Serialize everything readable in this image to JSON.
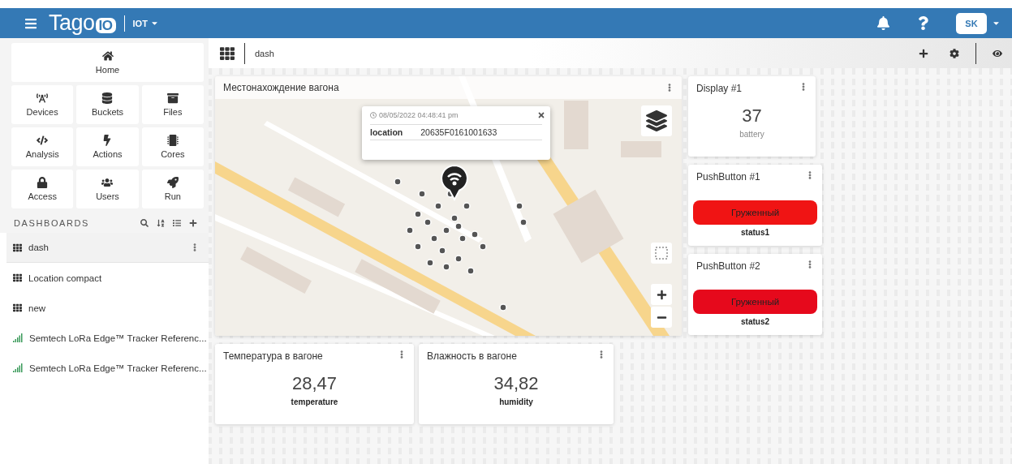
{
  "header": {
    "logo": "Tago",
    "logo_badge": "IO",
    "account": "IOT",
    "avatar": "SK"
  },
  "sidebar": {
    "nav": [
      {
        "label": "Home",
        "kind": "home"
      },
      {
        "label": "Devices",
        "kind": "devices"
      },
      {
        "label": "Buckets",
        "kind": "buckets"
      },
      {
        "label": "Files",
        "kind": "files"
      },
      {
        "label": "Analysis",
        "kind": "analysis"
      },
      {
        "label": "Actions",
        "kind": "actions"
      },
      {
        "label": "Cores",
        "kind": "cores"
      },
      {
        "label": "Access",
        "kind": "access"
      },
      {
        "label": "Users",
        "kind": "users"
      },
      {
        "label": "Run",
        "kind": "run"
      }
    ],
    "dashboards_title": "DASHBOARDS",
    "dashboards": [
      {
        "label": "dash",
        "kind": "grid",
        "selected": true
      },
      {
        "label": "Location compact",
        "kind": "grid",
        "selected": false
      },
      {
        "label": "new",
        "kind": "grid",
        "selected": false
      },
      {
        "label": "Semtech LoRa Edge™ Tracker Referenc...",
        "kind": "signal",
        "selected": false
      },
      {
        "label": "Semtech LoRa Edge™ Tracker Referenc...",
        "kind": "signal",
        "selected": false
      }
    ]
  },
  "toolbar": {
    "title": "dash"
  },
  "map": {
    "title": "Местонахождение вагона",
    "popup": {
      "time": "08/05/2022 04:48:41 pm",
      "key": "location",
      "value": "20635F0161001633"
    }
  },
  "side_widgets": [
    {
      "kind": "display",
      "title": "Display #1",
      "value": "37",
      "unit": "battery"
    },
    {
      "kind": "push",
      "title": "PushButton #1",
      "button": "Груженный",
      "label": "status1",
      "color": "#f01414"
    },
    {
      "kind": "push",
      "title": "PushButton #2",
      "button": "Груженный",
      "label": "status2",
      "color": "#e6091c"
    }
  ],
  "bottom_widgets": [
    {
      "title": "Температура в вагоне",
      "value": "28,47",
      "label": "temperature"
    },
    {
      "title": "Влажность в вагоне",
      "value": "34,82",
      "label": "humidity"
    }
  ]
}
